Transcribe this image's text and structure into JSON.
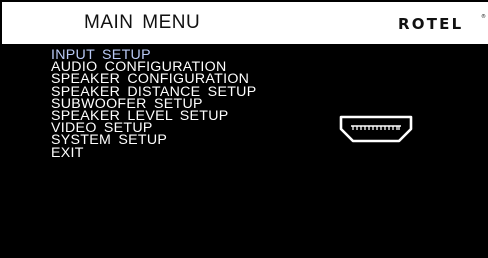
{
  "header": {
    "title": "MAIN  MENU",
    "brand": "ROTEL",
    "brand_mark": "®"
  },
  "menu": {
    "selected_color": "#b9c9f5",
    "items": [
      {
        "label": "INPUT  SETUP",
        "selected": true
      },
      {
        "label": "AUDIO  CONFIGURATION",
        "selected": false
      },
      {
        "label": "SPEAKER  CONFIGURATION",
        "selected": false
      },
      {
        "label": "SPEAKER  DISTANCE  SETUP",
        "selected": false
      },
      {
        "label": "SUBWOOFER  SETUP",
        "selected": false
      },
      {
        "label": "SPEAKER  LEVEL  SETUP",
        "selected": false
      },
      {
        "label": "VIDEO  SETUP",
        "selected": false
      },
      {
        "label": "SYSTEM  SETUP",
        "selected": false
      },
      {
        "label": "EXIT",
        "selected": false
      }
    ]
  },
  "icons": {
    "hdmi": "hdmi-icon"
  },
  "colors": {
    "background": "#000000",
    "header_background": "#ffffff",
    "text": "#ffffff"
  }
}
